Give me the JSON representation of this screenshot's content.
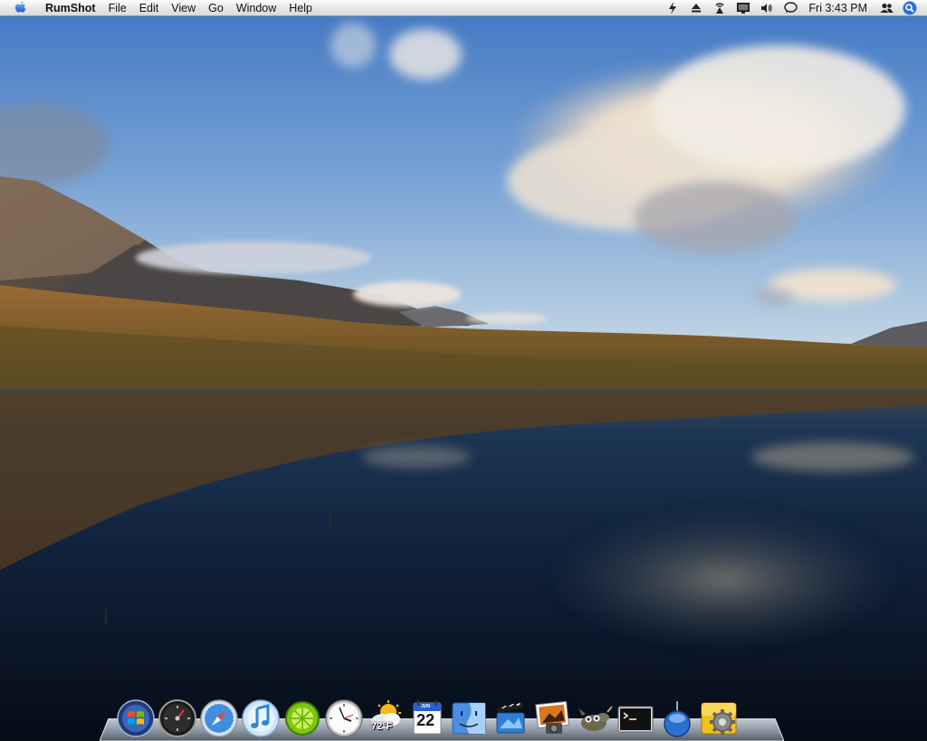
{
  "menubar": {
    "app_name": "RumShot",
    "menus": [
      "File",
      "Edit",
      "View",
      "Go",
      "Window",
      "Help"
    ],
    "clock": "Fri 3:43 PM",
    "status_icons": [
      "flash-icon",
      "eject-icon",
      "airport-icon",
      "display-icon",
      "volume-icon",
      "ichat-icon",
      "users-icon",
      "spotlight-icon"
    ]
  },
  "dock": {
    "items": [
      "windows-icon",
      "dashboard-icon",
      "safari-icon",
      "itunes-icon",
      "limewire-icon",
      "clock-icon",
      "weather-icon",
      "calendar-icon",
      "finder-icon",
      "imovie-icon",
      "iphoto-icon",
      "gimp-icon",
      "terminal-icon",
      "utility-icon",
      "system-preferences-icon"
    ],
    "weather_temp": "72°F",
    "calendar_month": "JUN",
    "calendar_day": "22"
  },
  "colors": {
    "sky_top": "#4a7fc6",
    "sky_horizon": "#c9d9e6",
    "water_dark": "#0b1626",
    "hills": "#8a5a2b"
  }
}
